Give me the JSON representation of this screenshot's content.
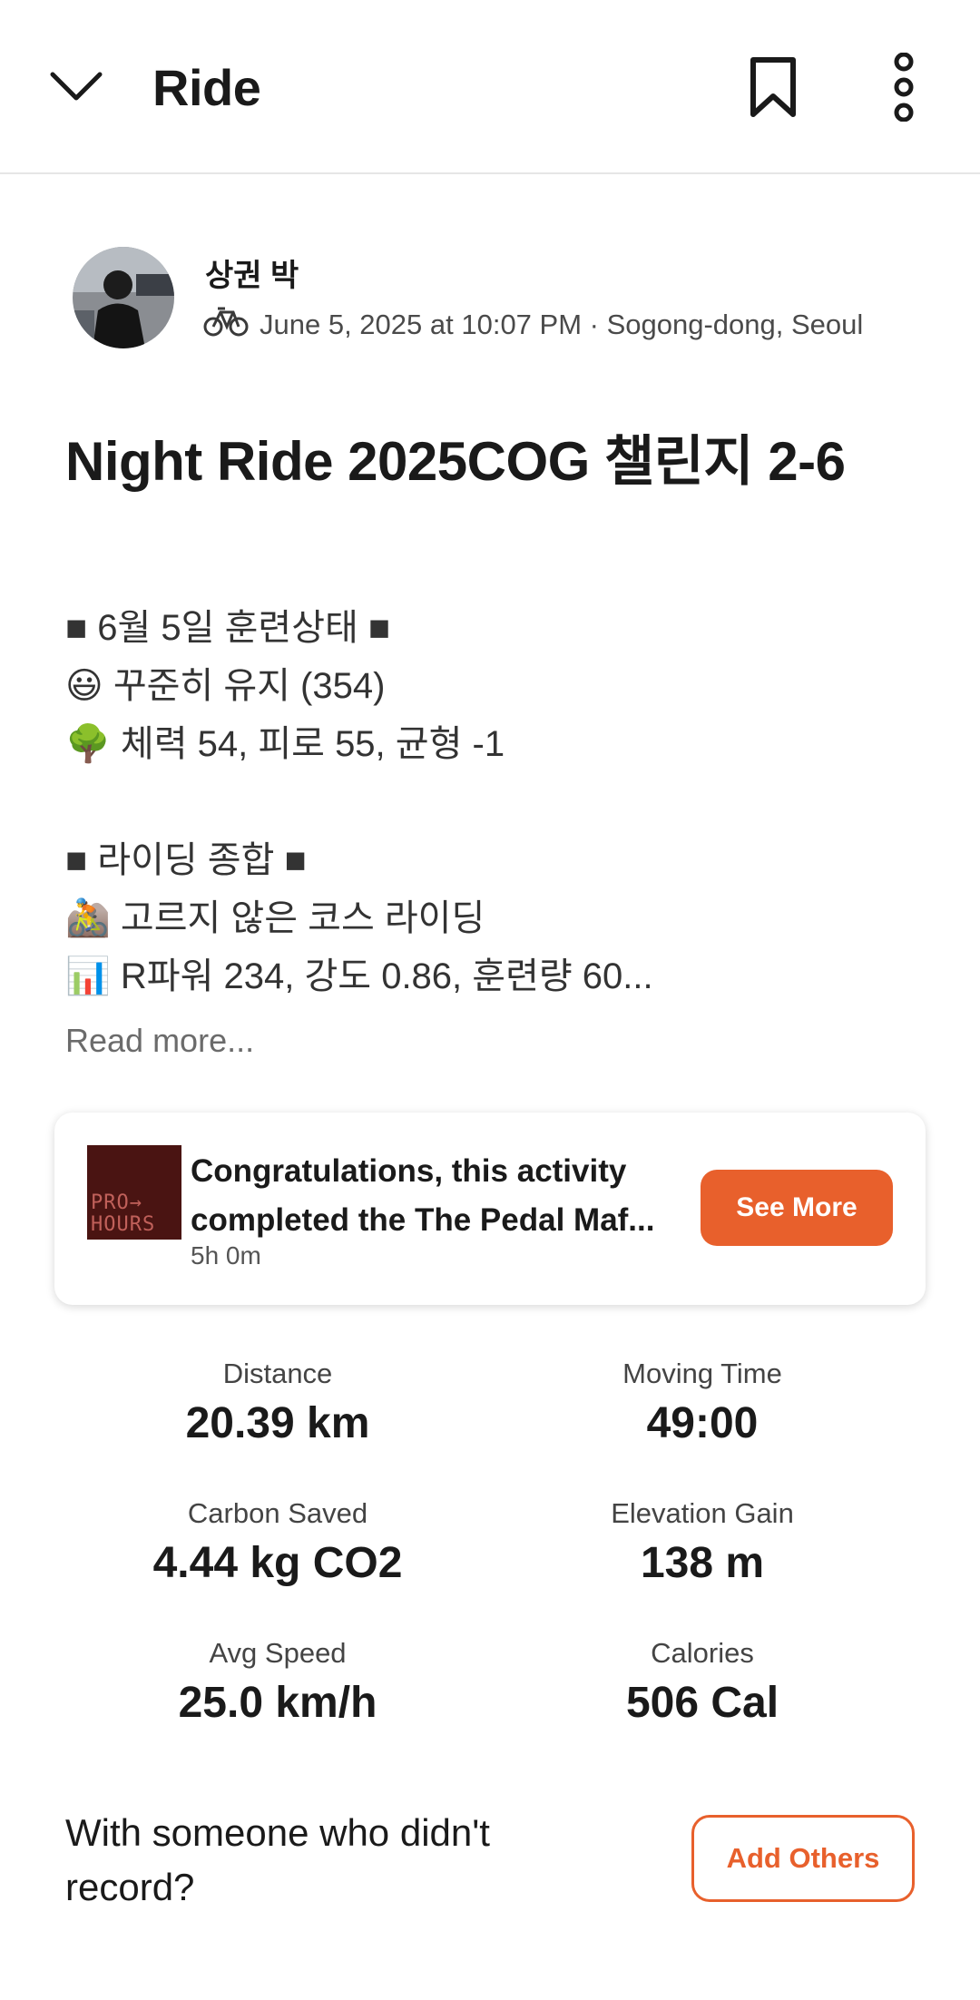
{
  "header": {
    "title": "Ride",
    "back_icon": "chevron-down-icon",
    "bookmark_icon": "bookmark-icon",
    "more_icon": "more-vertical-icon"
  },
  "athlete": {
    "name": "상권 박",
    "activity_icon": "bike-icon",
    "meta": "June 5, 2025 at 10:07 PM · Sogong-dong, Seoul"
  },
  "activity": {
    "title": "Night Ride 2025COG 챌린지 2-6",
    "description_lines": [
      "■ 6월 5일 훈련상태 ■",
      "😃 꾸준히 유지 (354)",
      "🌳 체력 54, 피로 55, 균형 -1",
      "",
      "■ 라이딩 종합 ■",
      "🚵 고르지 않은 코스 라이딩",
      "📊 R파워 234, 강도 0.86, 훈련량 60..."
    ],
    "read_more": "Read more..."
  },
  "achievement": {
    "line1": "Congratulations, this activity",
    "line2": "completed the The Pedal Maf...",
    "subtitle": "5h 0m",
    "thumb_text": "PRO→ HOURS",
    "button": "See More"
  },
  "stats": [
    {
      "label": "Distance",
      "value": "20.39 km"
    },
    {
      "label": "Moving Time",
      "value": "49:00"
    },
    {
      "label": "Carbon Saved",
      "value": "4.44 kg CO2"
    },
    {
      "label": "Elevation Gain",
      "value": "138 m"
    },
    {
      "label": "Avg Speed",
      "value": "25.0 km/h"
    },
    {
      "label": "Calories",
      "value": "506 Cal"
    }
  ],
  "with_others": {
    "text": "With someone who didn't record?",
    "button": "Add Others"
  },
  "colors": {
    "accent": "#e8602c",
    "text": "#1a1a1a",
    "muted": "#6b6b6b"
  }
}
